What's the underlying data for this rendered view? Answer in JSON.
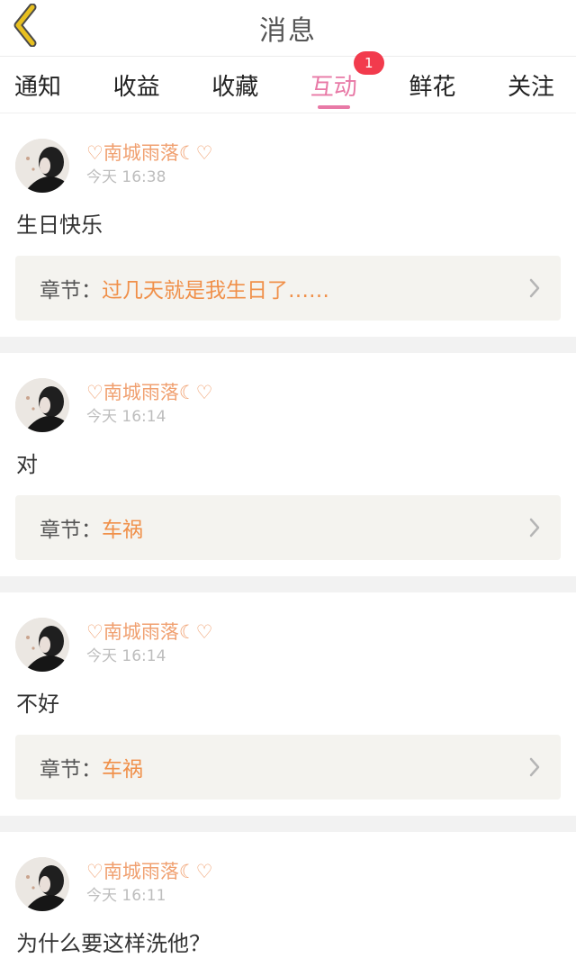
{
  "header": {
    "title": "消息"
  },
  "tabs": [
    {
      "label": "通知",
      "active": false
    },
    {
      "label": "收益",
      "active": false
    },
    {
      "label": "收藏",
      "active": false
    },
    {
      "label": "互动",
      "active": true,
      "badge": "1"
    },
    {
      "label": "鲜花",
      "active": false
    },
    {
      "label": "关注",
      "active": false
    }
  ],
  "colors": {
    "accent": "#e879a6",
    "badge": "#f23b4d",
    "name": "#f0a070",
    "chapter_title": "#f0904a",
    "back_arrow": "#e8c020"
  },
  "icons": {
    "back": "chevron-left-icon",
    "chevron": "chevron-right-icon"
  },
  "messages": [
    {
      "user": "♡南城雨落☾♡",
      "time": "今天 16:38",
      "content": "生日快乐",
      "chapter_label": "章节：",
      "chapter_title": "过几天就是我生日了……"
    },
    {
      "user": "♡南城雨落☾♡",
      "time": "今天 16:14",
      "content": "对",
      "chapter_label": "章节：",
      "chapter_title": "车祸"
    },
    {
      "user": "♡南城雨落☾♡",
      "time": "今天 16:14",
      "content": "不好",
      "chapter_label": "章节：",
      "chapter_title": "车祸"
    },
    {
      "user": "♡南城雨落☾♡",
      "time": "今天 16:11",
      "content": "为什么要这样洗他？"
    }
  ]
}
